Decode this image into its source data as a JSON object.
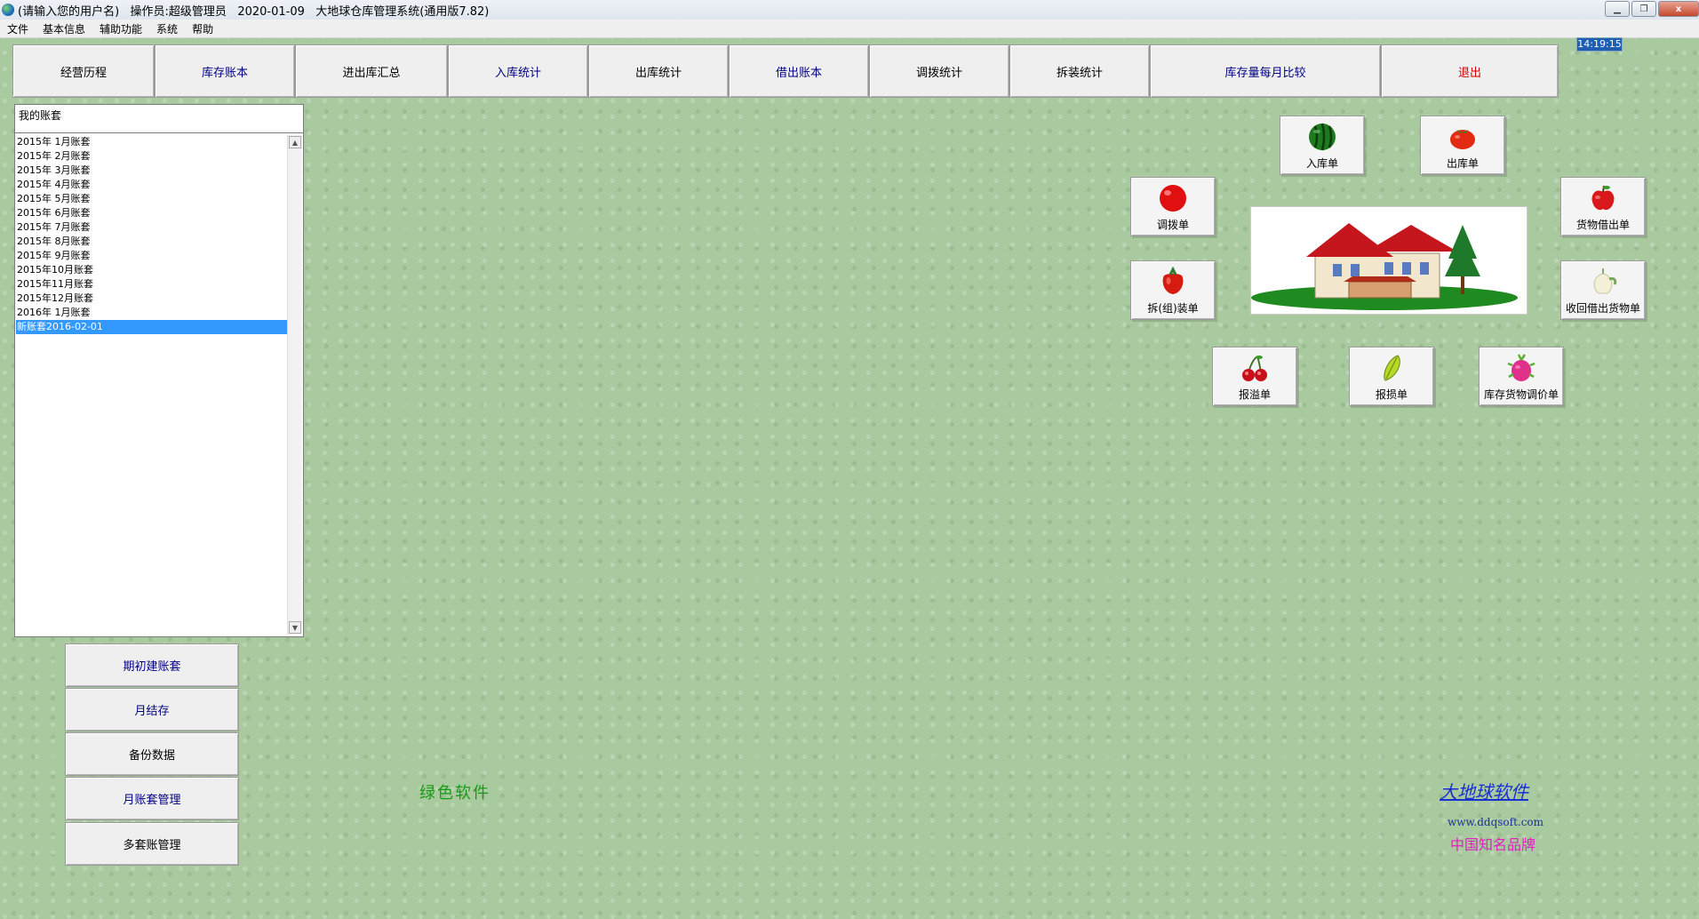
{
  "titlebar": {
    "text": "(请输入您的用户名)   操作员:超级管理员   2020-01-09   大地球仓库管理系统(通用版7.82)",
    "minimize": "▁",
    "restore": "❐",
    "close": "x"
  },
  "menu": [
    "文件",
    "基本信息",
    "辅助功能",
    "系统",
    "帮助"
  ],
  "clock": "14:19:15",
  "toolbar": [
    {
      "label": "经营历程",
      "color": "black"
    },
    {
      "label": "库存账本",
      "color": "navy"
    },
    {
      "label": "进出库汇总",
      "color": "black"
    },
    {
      "label": "入库统计",
      "color": "navy"
    },
    {
      "label": "出库统计",
      "color": "black"
    },
    {
      "label": "借出账本",
      "color": "navy"
    },
    {
      "label": "调拨统计",
      "color": "black"
    },
    {
      "label": "拆装统计",
      "color": "black"
    },
    {
      "label": "库存量每月比较",
      "color": "navy"
    },
    {
      "label": "退出",
      "color": "red"
    }
  ],
  "accounts": {
    "header": "我的账套",
    "items": [
      "2015年 1月账套",
      "2015年 2月账套",
      "2015年 3月账套",
      "2015年 4月账套",
      "2015年 5月账套",
      "2015年 6月账套",
      "2015年 7月账套",
      "2015年 8月账套",
      "2015年 9月账套",
      "2015年10月账套",
      "2015年11月账套",
      "2015年12月账套",
      "2016年 1月账套",
      "新账套2016-02-01"
    ],
    "selected_index": 13,
    "scroll_up": "▲",
    "scroll_down": "▼"
  },
  "left_buttons": [
    {
      "label": "期初建账套",
      "color": "navy"
    },
    {
      "label": "月结存",
      "color": "navy"
    },
    {
      "label": "备份数据",
      "color": "black"
    },
    {
      "label": "月账套管理",
      "color": "navy"
    },
    {
      "label": "多套账管理",
      "color": "black"
    }
  ],
  "icon_buttons": {
    "inbound": {
      "label": "入库单",
      "icon": "watermelon-icon"
    },
    "outbound": {
      "label": "出库单",
      "icon": "tomato-icon"
    },
    "transfer": {
      "label": "调拨单",
      "icon": "red-ball-icon"
    },
    "lend": {
      "label": "货物借出单",
      "icon": "apple-icon"
    },
    "assembly": {
      "label": "拆(组)装单",
      "icon": "pepper-icon"
    },
    "return": {
      "label": "收回借出货物单",
      "icon": "garlic-icon"
    },
    "overflow": {
      "label": "报溢单",
      "icon": "cherry-icon"
    },
    "loss": {
      "label": "报损单",
      "icon": "starfruit-icon"
    },
    "reprice": {
      "label": "库存货物调价单",
      "icon": "dragonfruit-icon"
    }
  },
  "footer": {
    "green_soft": "绿色软件",
    "brand": "大地球软件",
    "url": "www.ddqsoft.com",
    "slogan": "中国知名品牌"
  },
  "colors": {
    "background": "#a9c99f",
    "navy_text": "#000080",
    "red_text": "#d00000",
    "selection": "#3399ff",
    "clock_bg": "#1e5fb3"
  }
}
